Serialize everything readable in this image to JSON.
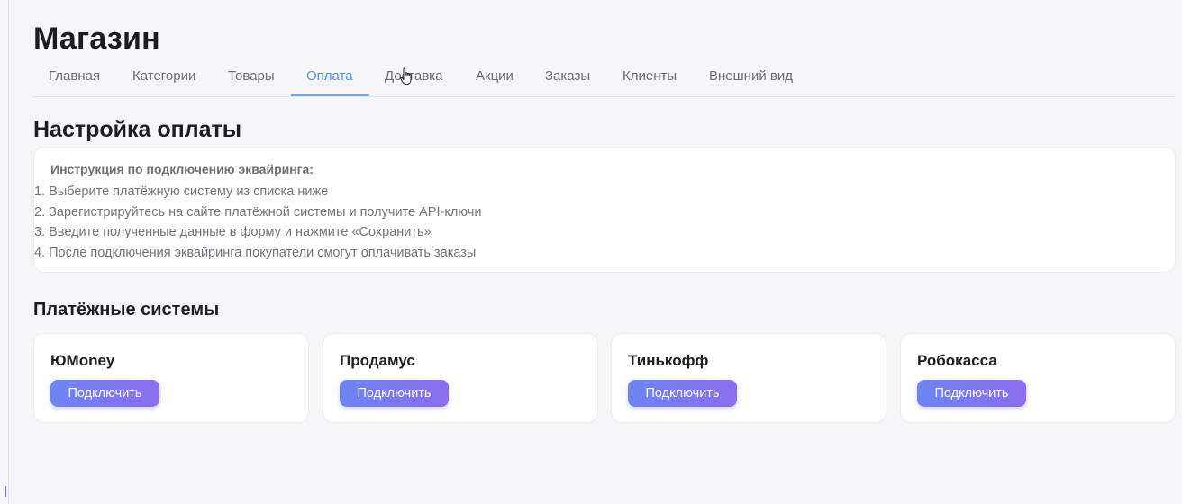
{
  "app": {
    "title": "Магазин"
  },
  "tabs": [
    {
      "label": "Главная",
      "active": false
    },
    {
      "label": "Категории",
      "active": false
    },
    {
      "label": "Товары",
      "active": false
    },
    {
      "label": "Оплата",
      "active": true
    },
    {
      "label": "Доставка",
      "active": false
    },
    {
      "label": "Акции",
      "active": false
    },
    {
      "label": "Заказы",
      "active": false
    },
    {
      "label": "Клиенты",
      "active": false
    },
    {
      "label": "Внешний вид",
      "active": false
    }
  ],
  "payment_settings": {
    "title": "Настройка оплаты",
    "instructions": {
      "heading": "Инструкция по подключению эквайринга:",
      "steps": [
        "1. Выберите платёжную систему из списка ниже",
        "2. Зарегистрируйтесь на сайте платёжной системы и получите API-ключи",
        "3. Введите полученные данные в форму и нажмите «Сохранить»",
        "4. После подключения эквайринга покупатели смогут оплачивать заказы"
      ]
    }
  },
  "payment_systems": {
    "title": "Платёжные системы",
    "items": [
      {
        "name": "ЮMoney",
        "button_label": "Подключить"
      },
      {
        "name": "Продамус",
        "button_label": "Подключить"
      },
      {
        "name": "Тинькофф",
        "button_label": "Подключить"
      },
      {
        "name": "Робокасса",
        "button_label": "Подключить"
      }
    ]
  },
  "colors": {
    "accent": "#4d95e6",
    "button_gradient_start": "#6c85f1",
    "button_gradient_end": "#8d6cf0",
    "background": "#f6f6f9"
  },
  "icons": {
    "cursor": "hand-pointer-cursor-icon"
  }
}
